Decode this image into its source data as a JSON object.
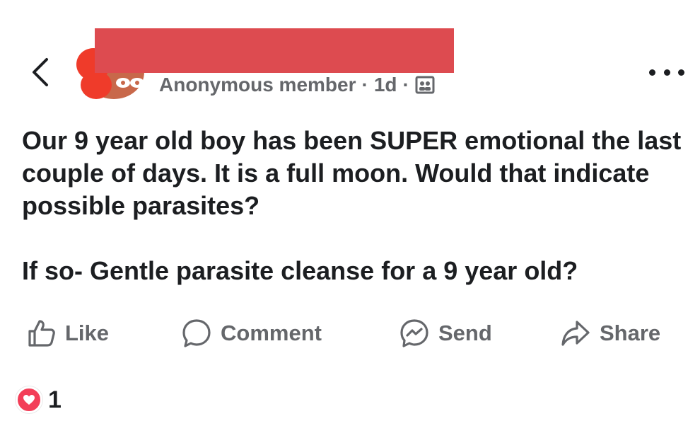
{
  "post": {
    "author": "Anonymous member",
    "time": "1d",
    "separator": "·",
    "audience_icon": "group-icon",
    "paragraph1": "Our 9 year old boy has been SUPER emotional the last couple of days. It is a full moon. Would that indicate possible parasites?",
    "paragraph2": "If so- Gentle parasite cleanse for a 9 year old?"
  },
  "actions": {
    "like": "Like",
    "comment": "Comment",
    "send": "Send",
    "share": "Share"
  },
  "reactions": {
    "icon": "heart-icon",
    "count": "1"
  },
  "colors": {
    "secondary_text": "#65676b",
    "primary_text": "#1c1e21",
    "redaction": "#dd4b50",
    "heart": "#f33e58"
  }
}
